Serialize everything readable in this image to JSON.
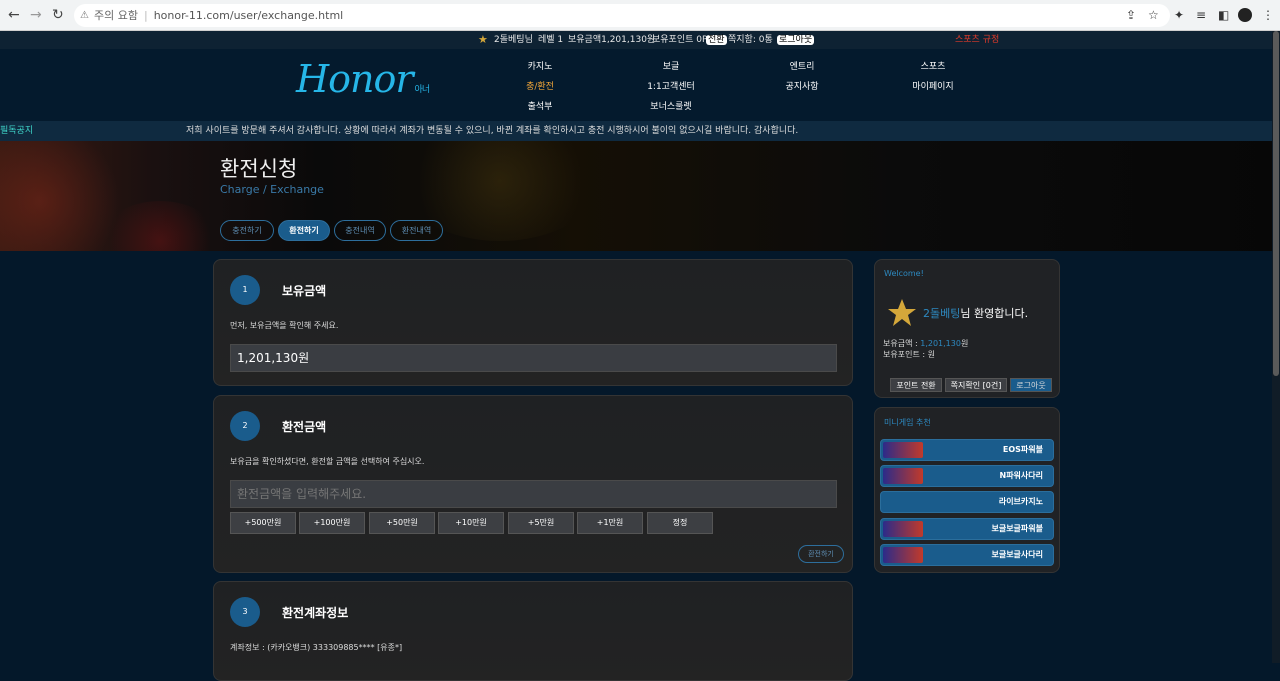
{
  "browser": {
    "warning": "주의 요함",
    "url": "honor-11.com/user/exchange.html"
  },
  "topbar": {
    "nick": "2돌베팅님",
    "level": "레벨 1",
    "balance_label": "보유금액1,201,130원",
    "point_label": "보유포인트 0P",
    "point_btn": "전환",
    "msg_label": "쪽지함: 0통",
    "logout": "로그아웃",
    "sports_rules": "스포츠 규정"
  },
  "logo": {
    "text": "Honor",
    "sub": "아너"
  },
  "menu": [
    {
      "label": "카지노"
    },
    {
      "label": "보글"
    },
    {
      "label": "엔트리"
    },
    {
      "label": "스포츠"
    },
    {
      "label": "충/환전"
    },
    {
      "label": "1:1고객센터"
    },
    {
      "label": "공지사항"
    },
    {
      "label": "마이페이지"
    },
    {
      "label": "출석부"
    },
    {
      "label": "보너스룰렛"
    }
  ],
  "ticker": {
    "tag": "필독공지",
    "message": "저희 사이트를 방문해 주셔서 감사합니다. 상황에 따라서 계좌가 변동될 수 있으니, 바뀐 계좌를 확인하시고 충전 시행하시어 불이익 없으시길 바랍니다. 감사합니다."
  },
  "hero": {
    "title": "환전신청",
    "subtitle": "Charge / Exchange"
  },
  "tabs": [
    {
      "label": "충전하기"
    },
    {
      "label": "환전하기"
    },
    {
      "label": "충전내역"
    },
    {
      "label": "환전내역"
    }
  ],
  "card1": {
    "step": "1",
    "title": "보유금액",
    "desc": "먼저, 보유금액을 확인해 주세요.",
    "value": "1,201,130원"
  },
  "card2": {
    "step": "2",
    "title": "환전금액",
    "desc": "보유금을 확인하셨다면, 환전할 금액을 선택하여 주십시오.",
    "placeholder": "환전금액을 입력해주세요.",
    "amounts": [
      "+500만원",
      "+100만원",
      "+50만원",
      "+10만원",
      "+5만원",
      "+1만원",
      "정정"
    ],
    "submit": "환전하기"
  },
  "card3": {
    "step": "3",
    "title": "환전계좌정보",
    "desc": "계좌정보 : (카카오뱅크) 333309885**** [유종*]"
  },
  "side": {
    "welcome": "Welcome!",
    "nick": "2돌베팅",
    "greet": "님 환영합니다.",
    "balance_label": "보유금액 : ",
    "balance_val": "1,201,130",
    "balance_unit": "원",
    "point_label": "보유포인트 : ",
    "point_unit": "원",
    "btn_point": "포인트 전환",
    "btn_msg": "쪽지확인 [0건]",
    "btn_logout": "로그아웃"
  },
  "minigame": {
    "title": "미니게임 추천",
    "items": [
      {
        "label": "EOS파워볼"
      },
      {
        "label": "N파워사다리"
      },
      {
        "label": "라이브카지노"
      },
      {
        "label": "보글보글파워볼"
      },
      {
        "label": "보글보글사다리"
      }
    ]
  }
}
